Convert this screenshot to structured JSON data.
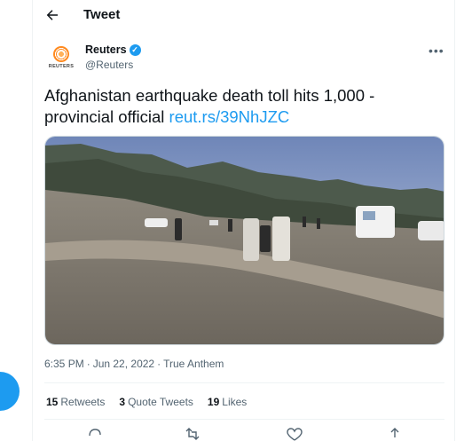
{
  "header": {
    "title": "Tweet"
  },
  "author": {
    "name": "Reuters",
    "handle": "@Reuters",
    "avatar_text": "REUTERS"
  },
  "tweet": {
    "text": "Afghanistan earthquake death toll hits 1,000 - provincial official",
    "link": "reut.rs/39NhJZC"
  },
  "meta": {
    "time": "6:35 PM",
    "separator": "·",
    "date": "Jun 22, 2022",
    "source": "True Anthem"
  },
  "stats": [
    {
      "count": "15",
      "label": "Retweets"
    },
    {
      "count": "3",
      "label": "Quote Tweets"
    },
    {
      "count": "19",
      "label": "Likes"
    }
  ],
  "icons": [
    "back-arrow-icon",
    "verified-icon",
    "more-icon",
    "reply-icon",
    "retweet-icon",
    "like-icon",
    "share-icon"
  ],
  "colors": {
    "accent": "#1d9bf0",
    "text": "#0f1419",
    "secondary": "#536471",
    "border": "#eff3f4"
  }
}
